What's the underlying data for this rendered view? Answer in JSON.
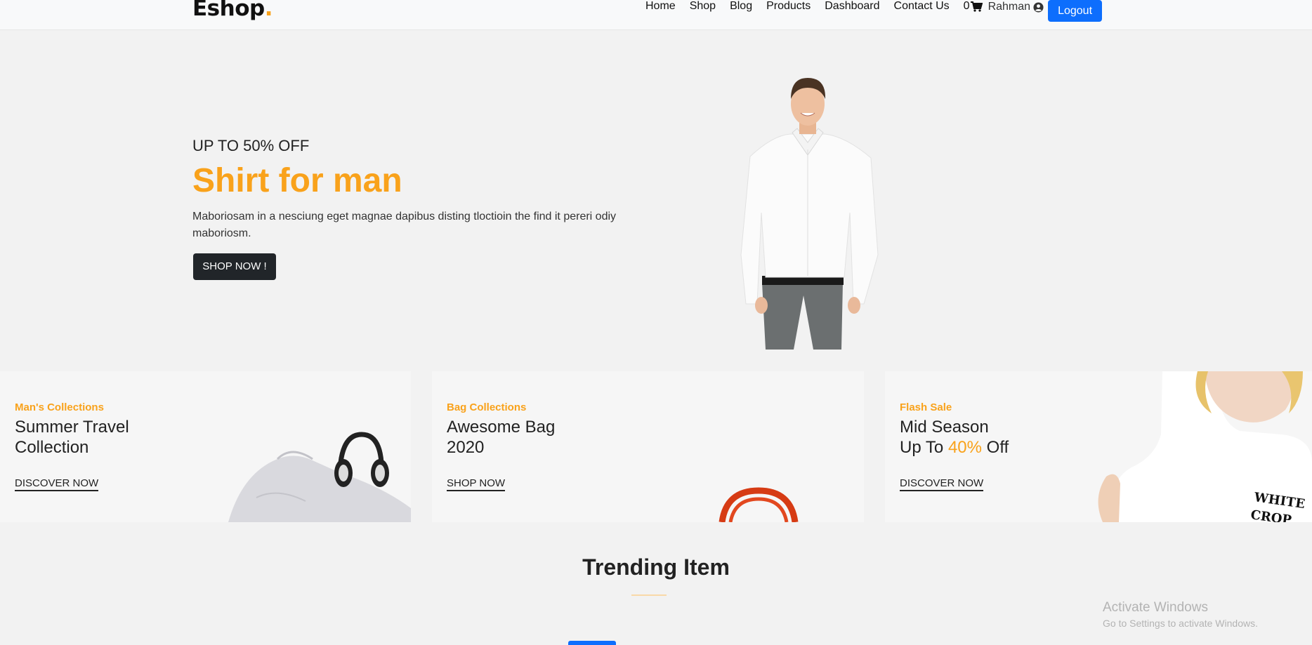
{
  "header": {
    "logo": "Eshop",
    "logo_dot": ".",
    "nav": [
      "Home",
      "Shop",
      "Blog",
      "Products",
      "Dashboard",
      "Contact Us"
    ],
    "cart_count": "0",
    "user_name": "Rahman",
    "logout_label": "Logout"
  },
  "hero": {
    "subtitle": "UP TO 50% OFF",
    "title": "Shirt for man",
    "description": "Maboriosam in a nesciung eget magnae dapibus disting tloctioin the find it pereri odiy maboriosm.",
    "button_label": "SHOP NOW !"
  },
  "collections": [
    {
      "tag": "Man's Collections",
      "title_line1": "Summer Travel",
      "title_line2": "Collection",
      "link": "DISCOVER NOW"
    },
    {
      "tag": "Bag Collections",
      "title_line1": "Awesome Bag",
      "title_line2": "2020",
      "link": "SHOP NOW"
    },
    {
      "tag": "Flash Sale",
      "title_line1": "Mid Season",
      "title_line2_pre": "Up To ",
      "title_line2_accent": "40%",
      "title_line2_post": " Off",
      "link": "DISCOVER NOW",
      "shirt_print_line1": "WHITE",
      "shirt_print_line2": "CROP"
    }
  ],
  "trending": {
    "title": "Trending Item"
  },
  "watermark": {
    "title": "Activate Windows",
    "subtitle": "Go to Settings to activate Windows."
  },
  "colors": {
    "accent": "#f9a21b",
    "primary": "#0d6efd",
    "dark": "#212529"
  }
}
